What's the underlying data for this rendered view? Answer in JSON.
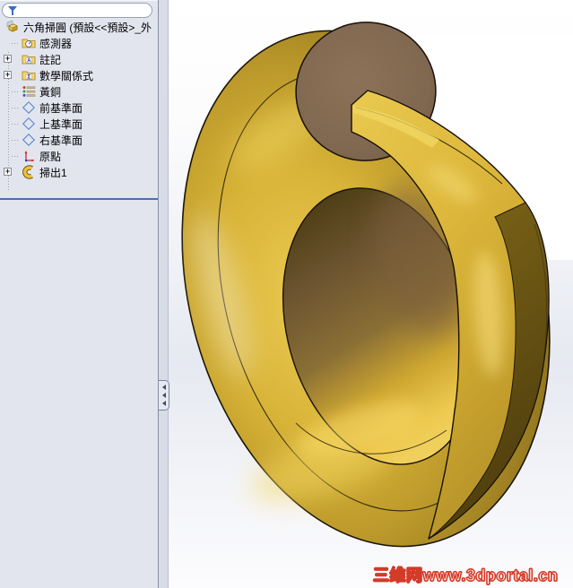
{
  "feature_tree": {
    "filter_placeholder": "",
    "expander_glyph": "+",
    "root": {
      "label": "六角掃圓 (預設<<預設>_外",
      "icon": "part-icon"
    },
    "items": [
      {
        "label": "感測器",
        "icon": "sensors-folder-icon",
        "has_expander": false
      },
      {
        "label": "註記",
        "icon": "annotations-folder-icon",
        "has_expander": true,
        "icon_glyph": "A"
      },
      {
        "label": "數學關係式",
        "icon": "equations-folder-icon",
        "has_expander": true,
        "icon_glyph": "Σ"
      },
      {
        "label": "黃銅",
        "icon": "material-appearance-icon",
        "has_expander": false
      },
      {
        "label": "前基準面",
        "icon": "reference-plane-icon",
        "has_expander": false
      },
      {
        "label": "上基準面",
        "icon": "reference-plane-icon",
        "has_expander": false
      },
      {
        "label": "右基準面",
        "icon": "reference-plane-icon",
        "has_expander": false
      },
      {
        "label": "原點",
        "icon": "origin-icon",
        "has_expander": false
      },
      {
        "label": "掃出1",
        "icon": "sweep-feature-icon",
        "has_expander": true
      }
    ]
  },
  "splitter": {
    "collapse_icon": "triple-left-arrow-icon"
  },
  "viewport": {
    "model_name": "六角掃圓",
    "watermark": "三维网www.3dportal.cn",
    "colors": {
      "brass_bright": "#ecca52",
      "brass_mid": "#c9a52e",
      "brass_dark": "#4a3a0d",
      "end_face_brown": "#82694f",
      "edge": "#1a1408",
      "background_top": "#ffffff",
      "background_mid": "#e6e9f1",
      "watermark_red": "#d43a28",
      "separator_blue": "#4a6fae"
    }
  }
}
